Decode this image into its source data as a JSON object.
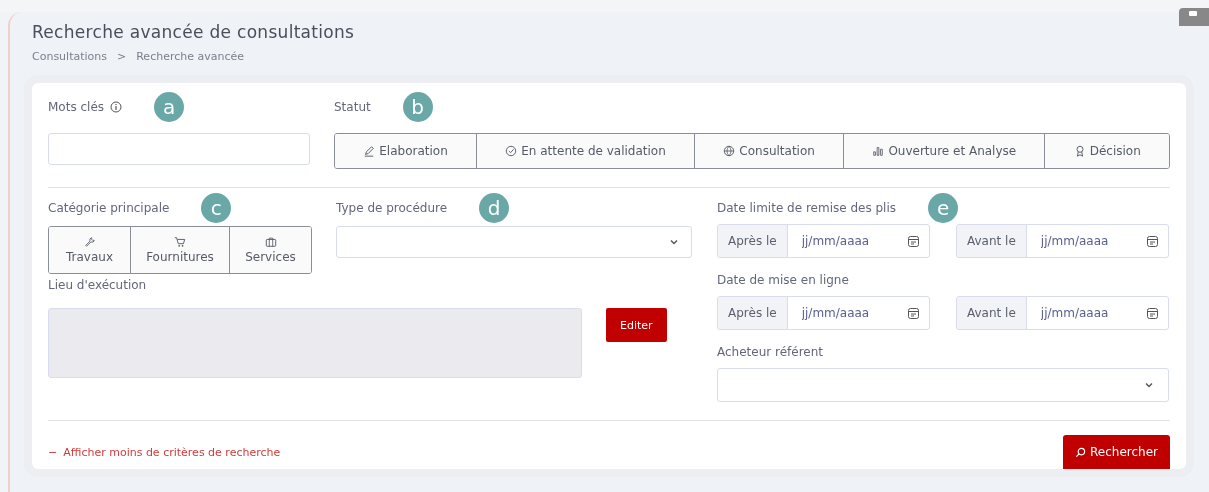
{
  "page": {
    "title": "Recherche avancée de consultations",
    "breadcrumb": [
      "Consultations",
      ">",
      "Recherche avancée"
    ]
  },
  "keywords": {
    "label": "Mots clés",
    "marker": "a"
  },
  "statut": {
    "label": "Statut",
    "marker": "b",
    "options": [
      {
        "label": "Elaboration",
        "selected": false
      },
      {
        "label": "En attente de validation",
        "selected": false
      },
      {
        "label": "Consultation",
        "selected": false
      },
      {
        "label": "Ouverture et Analyse",
        "selected": false
      },
      {
        "label": "Décision",
        "selected": false
      }
    ]
  },
  "categorie": {
    "label": "Catégorie principale",
    "marker": "c",
    "options": [
      {
        "label": "Travaux",
        "selected": false
      },
      {
        "label": "Fournitures",
        "selected": false
      },
      {
        "label": "Services",
        "selected": false
      }
    ]
  },
  "procedure": {
    "label": "Type de procédure",
    "marker": "d"
  },
  "lieu": {
    "label": "Lieu d'exécution",
    "button": "Editer"
  },
  "date_groups": [
    {
      "label": "Date limite de remise des plis",
      "marker": "e",
      "ranges": [
        {
          "prefix": "Après le",
          "placeholder": "jj/mm/aaaa"
        },
        {
          "prefix": "Avant le",
          "placeholder": "jj/mm/aaaa"
        }
      ]
    },
    {
      "label": "Date de mise en ligne",
      "ranges": [
        {
          "prefix": "Après le",
          "placeholder": "jj/mm/aaaa"
        },
        {
          "prefix": "Avant le",
          "placeholder": "jj/mm/aaaa"
        }
      ]
    }
  ],
  "acheteur": {
    "label": "Acheteur référent"
  },
  "footer": {
    "toggle_icon": "−",
    "toggle": "Afficher moins de critères de recherche",
    "search": "Rechercher"
  }
}
